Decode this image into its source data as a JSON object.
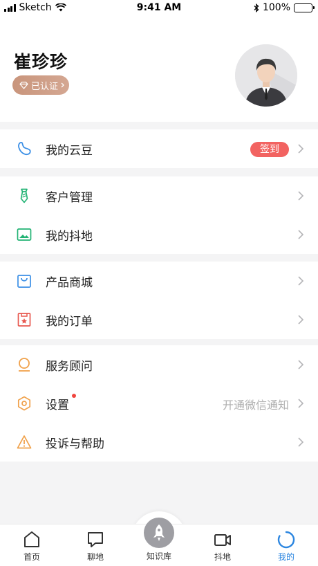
{
  "status_bar": {
    "carrier": "Sketch",
    "time": "9:41 AM",
    "battery": "100%"
  },
  "profile": {
    "name": "崔珍珍",
    "verified_label": "已认证"
  },
  "menu": {
    "coins": {
      "label": "我的云豆",
      "badge": "签到",
      "icon": "bean-icon"
    },
    "customers": {
      "label": "客户管理",
      "icon": "tie-icon"
    },
    "douyin": {
      "label": "我的抖地",
      "icon": "image-icon"
    },
    "store": {
      "label": "产品商城",
      "icon": "shopping-bag-icon"
    },
    "orders": {
      "label": "我的订单",
      "icon": "order-icon"
    },
    "advisor": {
      "label": "服务顾问",
      "icon": "advisor-icon"
    },
    "settings": {
      "label": "设置",
      "extra": "开通微信通知",
      "icon": "settings-icon"
    },
    "complaints": {
      "label": "投诉与帮助",
      "icon": "warning-icon"
    }
  },
  "tabs": {
    "home": "首页",
    "chat": "聊地",
    "knowledge": "知识库",
    "douyin": "抖地",
    "me": "我的"
  },
  "colors": {
    "accent": "#2c86e0",
    "badge_red": "#f26361",
    "verified_gold": "#c9957c"
  }
}
